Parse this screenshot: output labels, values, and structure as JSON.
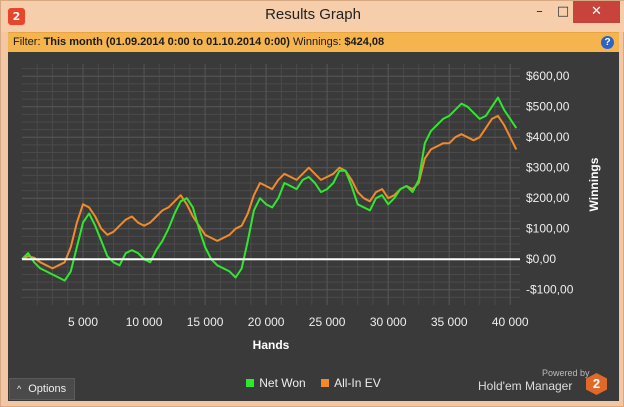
{
  "window": {
    "title": "Results Graph",
    "icon_label": "2",
    "minimize_glyph": "–",
    "maximize_glyph": "□",
    "close_glyph": "✕"
  },
  "filter": {
    "prefix": "Filter:",
    "value": "This month (01.09.2014 0:00 to 01.10.2014 0:00)",
    "winnings_label": "Winnings:",
    "winnings_value": "$424,08",
    "help_glyph": "?"
  },
  "footer": {
    "options_label": "Options",
    "options_chevron": "^",
    "powered_by": "Powered by",
    "brand_name": "Hold'em Manager",
    "brand_logo": "2"
  },
  "colors": {
    "net_won": "#2ee82e",
    "all_in_ev": "#f08a2c",
    "zero_line": "#ffffff",
    "grid": "#555555",
    "plot_bg": "#3a3a3a"
  },
  "chart_data": {
    "type": "line",
    "xlabel": "Hands",
    "ylabel": "Winnings",
    "xlim": [
      0,
      40800
    ],
    "ylim": [
      -150,
      640
    ],
    "x_ticks": [
      5000,
      10000,
      15000,
      20000,
      25000,
      30000,
      35000,
      40000
    ],
    "x_tick_labels": [
      "5 000",
      "10 000",
      "15 000",
      "20 000",
      "25 000",
      "30 000",
      "35 000",
      "40 000"
    ],
    "y_ticks": [
      -100,
      0,
      100,
      200,
      300,
      400,
      500,
      600
    ],
    "y_tick_labels": [
      "-$100,00",
      "$0,00",
      "$100,00",
      "$200,00",
      "$300,00",
      "$400,00",
      "$500,00",
      "$600,00"
    ],
    "grid": true,
    "legend": "bottom-center",
    "series": [
      {
        "name": "Net Won",
        "x": [
          0,
          500,
          1000,
          1500,
          2000,
          2500,
          3000,
          3500,
          4000,
          4500,
          5000,
          5500,
          6000,
          6500,
          7000,
          7500,
          8000,
          8500,
          9000,
          9500,
          10000,
          10500,
          11000,
          11500,
          12000,
          12500,
          13000,
          13500,
          14000,
          14500,
          15000,
          15500,
          16000,
          16500,
          17000,
          17500,
          18000,
          18500,
          19000,
          19500,
          20000,
          20500,
          21000,
          21500,
          22000,
          22500,
          23000,
          23500,
          24000,
          24500,
          25000,
          25500,
          26000,
          26500,
          27000,
          27500,
          28000,
          28500,
          29000,
          29500,
          30000,
          30500,
          31000,
          31500,
          32000,
          32500,
          33000,
          33500,
          34000,
          34500,
          35000,
          35500,
          36000,
          36500,
          37000,
          37500,
          38000,
          38500,
          39000,
          39500,
          40000,
          40500
        ],
        "values": [
          0,
          20,
          -10,
          -30,
          -40,
          -50,
          -60,
          -70,
          -40,
          40,
          120,
          150,
          110,
          60,
          10,
          -10,
          -20,
          20,
          30,
          20,
          0,
          -10,
          30,
          60,
          100,
          150,
          190,
          200,
          170,
          100,
          40,
          0,
          -20,
          -30,
          -40,
          -60,
          -30,
          60,
          160,
          200,
          180,
          170,
          200,
          250,
          240,
          230,
          260,
          270,
          250,
          220,
          230,
          250,
          290,
          290,
          240,
          180,
          170,
          160,
          200,
          210,
          180,
          200,
          230,
          240,
          220,
          260,
          380,
          420,
          440,
          460,
          470,
          490,
          510,
          500,
          480,
          460,
          470,
          500,
          530,
          490,
          460,
          430
        ]
      },
      {
        "name": "All-In EV",
        "x": [
          0,
          500,
          1000,
          1500,
          2000,
          2500,
          3000,
          3500,
          4000,
          4500,
          5000,
          5500,
          6000,
          6500,
          7000,
          7500,
          8000,
          8500,
          9000,
          9500,
          10000,
          10500,
          11000,
          11500,
          12000,
          12500,
          13000,
          13500,
          14000,
          14500,
          15000,
          15500,
          16000,
          16500,
          17000,
          17500,
          18000,
          18500,
          19000,
          19500,
          20000,
          20500,
          21000,
          21500,
          22000,
          22500,
          23000,
          23500,
          24000,
          24500,
          25000,
          25500,
          26000,
          26500,
          27000,
          27500,
          28000,
          28500,
          29000,
          29500,
          30000,
          30500,
          31000,
          31500,
          32000,
          32500,
          33000,
          33500,
          34000,
          34500,
          35000,
          35500,
          36000,
          36500,
          37000,
          37500,
          38000,
          38500,
          39000,
          39500,
          40000,
          40500
        ],
        "values": [
          0,
          10,
          5,
          -10,
          -20,
          -30,
          -20,
          -10,
          40,
          120,
          180,
          170,
          140,
          100,
          80,
          90,
          110,
          130,
          140,
          120,
          110,
          120,
          140,
          160,
          170,
          190,
          210,
          180,
          140,
          110,
          80,
          70,
          60,
          70,
          80,
          100,
          110,
          150,
          210,
          250,
          240,
          230,
          260,
          280,
          270,
          260,
          280,
          300,
          280,
          260,
          270,
          280,
          300,
          290,
          260,
          220,
          200,
          190,
          220,
          230,
          200,
          210,
          230,
          240,
          230,
          250,
          330,
          360,
          370,
          380,
          380,
          400,
          410,
          400,
          390,
          400,
          430,
          460,
          470,
          440,
          400,
          360
        ]
      }
    ]
  }
}
